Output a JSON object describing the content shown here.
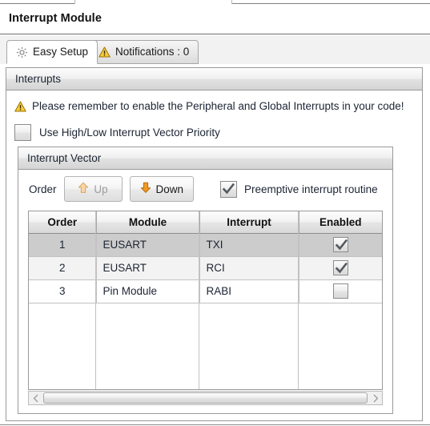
{
  "window": {
    "title": "Interrupt Module"
  },
  "tabs": [
    {
      "label": "Easy Setup",
      "icon": "gear-icon",
      "active": true
    },
    {
      "label": "Notifications : 0",
      "icon": "warning-triangle-icon",
      "active": false
    }
  ],
  "interrupts_panel": {
    "title": "Interrupts",
    "warning": {
      "icon": "warning-triangle-icon",
      "text": "Please remember to enable the Peripheral and Global Interrupts in your code!"
    },
    "high_low_priority": {
      "label": "Use High/Low Interrupt Vector Priority",
      "checked": false
    }
  },
  "vector_panel": {
    "title": "Interrupt Vector",
    "order_label": "Order",
    "up_button": {
      "label": "Up",
      "icon": "arrow-up-icon",
      "enabled": false
    },
    "down_button": {
      "label": "Down",
      "icon": "arrow-down-icon",
      "enabled": true
    },
    "preemptive": {
      "label": "Preemptive interrupt routine",
      "checked": true
    },
    "table": {
      "columns": [
        "Order",
        "Module",
        "Interrupt",
        "Enabled"
      ],
      "rows": [
        {
          "order": "1",
          "module": "EUSART",
          "interrupt": "TXI",
          "enabled": true,
          "state": "selected"
        },
        {
          "order": "2",
          "module": "EUSART",
          "interrupt": "RCI",
          "enabled": true,
          "state": "alt"
        },
        {
          "order": "3",
          "module": "Pin Module",
          "interrupt": "RABI",
          "enabled": false,
          "state": "plain"
        }
      ]
    },
    "scrollbar": {
      "left_arrow": "chevron-left-icon",
      "right_arrow": "chevron-right-icon"
    }
  },
  "colors": {
    "accent_orange": "#e08214",
    "accent_orange_disabled": "#f0c48a",
    "warning_yellow": "#f2c200",
    "selected_row": "#cccccc",
    "panel_border": "#9a9a9a"
  }
}
